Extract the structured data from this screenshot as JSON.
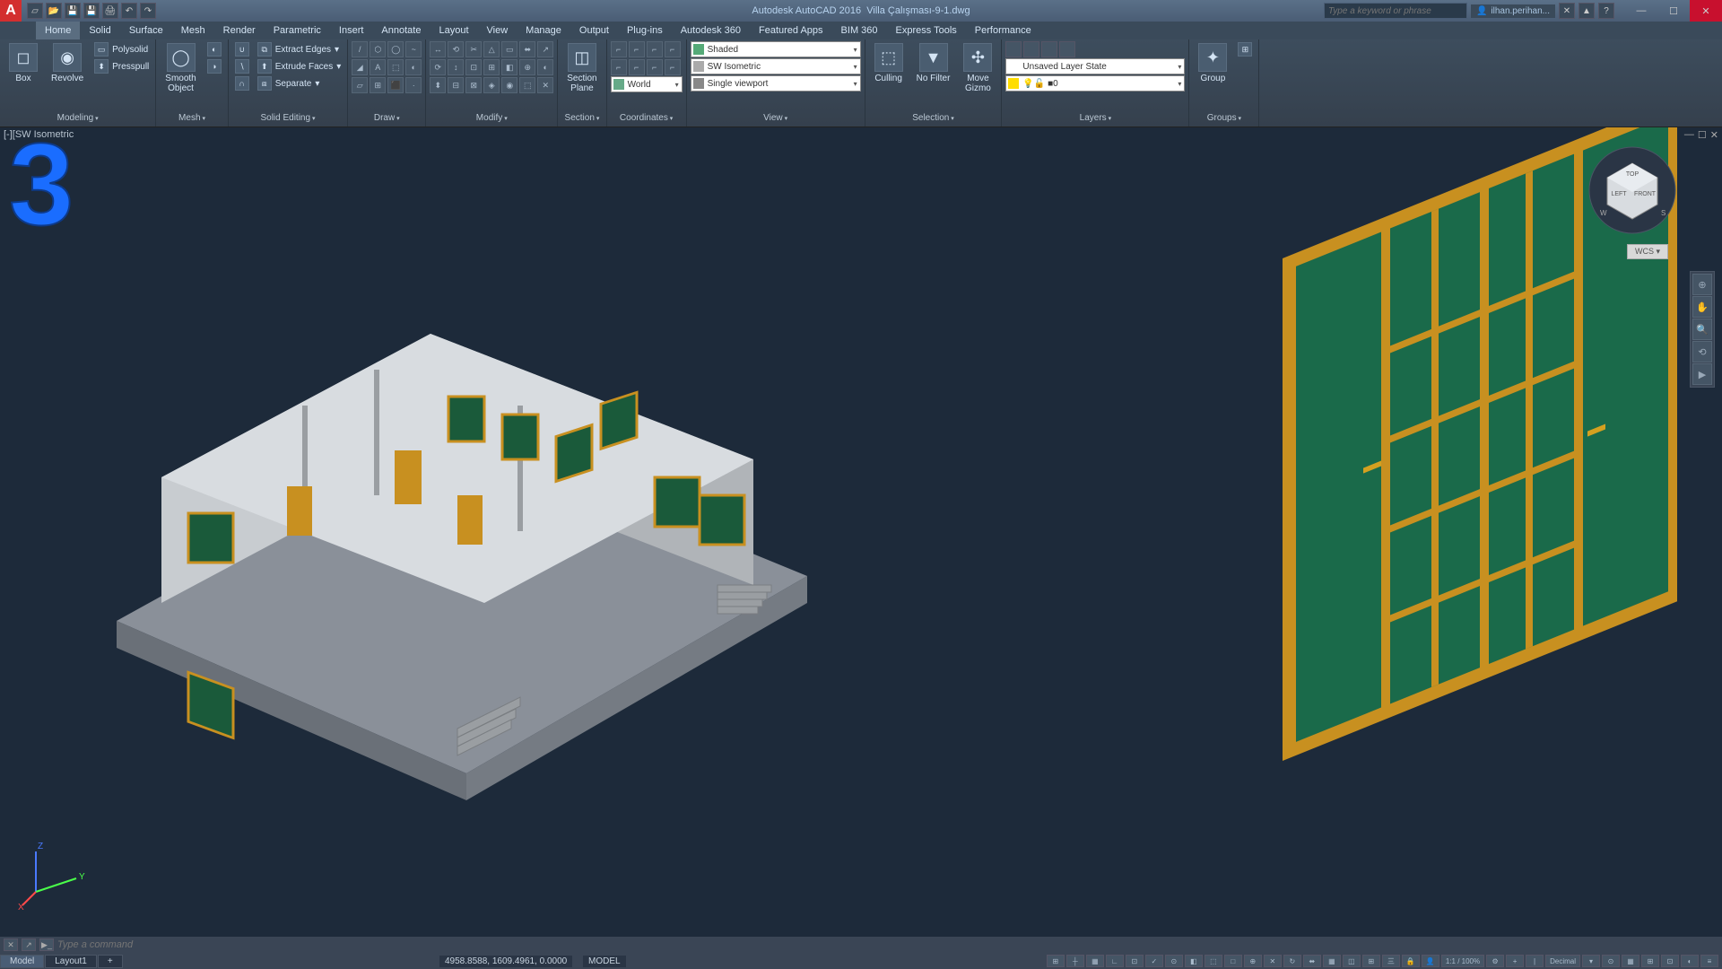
{
  "title": {
    "app": "Autodesk AutoCAD 2016",
    "file": "Villa Çalışması-9-1.dwg"
  },
  "search_placeholder": "Type a keyword or phrase",
  "user": "ilhan.perihan...",
  "menu": [
    "Home",
    "Solid",
    "Surface",
    "Mesh",
    "Render",
    "Parametric",
    "Insert",
    "Annotate",
    "Layout",
    "View",
    "Manage",
    "Output",
    "Plug-ins",
    "Autodesk 360",
    "Featured Apps",
    "BIM 360",
    "Express Tools",
    "Performance"
  ],
  "ribbon": {
    "modeling": {
      "label": "Modeling",
      "box": "Box",
      "revolve": "Revolve",
      "polysolid": "Polysolid",
      "presspull": "Presspull"
    },
    "mesh": {
      "label": "Mesh",
      "smooth": "Smooth\nObject"
    },
    "solid_editing": {
      "label": "Solid Editing",
      "extract": "Extract Edges",
      "extrude": "Extrude Faces",
      "separate": "Separate"
    },
    "draw": {
      "label": "Draw"
    },
    "modify": {
      "label": "Modify"
    },
    "section": {
      "label": "Section",
      "plane": "Section\nPlane"
    },
    "coordinates": {
      "label": "Coordinates",
      "world": "World"
    },
    "view": {
      "label": "View",
      "shaded": "Shaded",
      "iso": "SW Isometric",
      "viewport": "Single viewport"
    },
    "selection": {
      "label": "Selection",
      "culling": "Culling",
      "nofilter": "No Filter",
      "move": "Move\nGizmo"
    },
    "layers": {
      "label": "Layers",
      "state": "Unsaved Layer State",
      "current": "0"
    },
    "groups": {
      "label": "Groups",
      "group": "Group"
    }
  },
  "viewport": {
    "label": "[-][SW Isometric",
    "wcs": "WCS",
    "big_number": "3"
  },
  "command": {
    "placeholder": "Type a command"
  },
  "status": {
    "model": "Model",
    "layout": "Layout1",
    "coords": "4958.8588, 1609.4961, 0.0000",
    "mode": "MODEL",
    "zoom": "1:1 / 100%",
    "units": "Decimal"
  }
}
